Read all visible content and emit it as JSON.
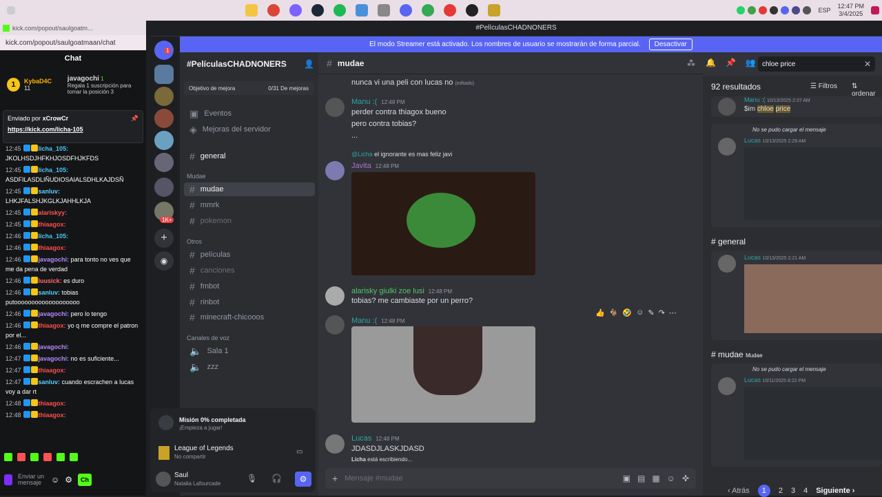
{
  "taskbar": {
    "time": "12:47 PM",
    "date": "3/4/2025",
    "lang": "ESP"
  },
  "kick": {
    "window_title": "kick.com/popout/saulgoatm...",
    "url": "kick.com/popout/saulgoatmaan/chat",
    "chat_title": "Chat",
    "gift_user": "KybaD4C",
    "gift_count": "11",
    "gifter": "javagochi",
    "gifter_count": "1",
    "gift_text": "Regala 1 suscripción para tomar la posición 3",
    "pinned_by": "Enviado por",
    "pinned_user": "xCrowCr",
    "pinned_link": "https://kick.com/licha-105",
    "messages": [
      {
        "t": "12:45",
        "u": "licha_105:",
        "c": "#4fc3f7",
        "m": "JKOLHSDJHFKHJOSDFHJKFDS"
      },
      {
        "t": "12:45",
        "u": "licha_105:",
        "c": "#4fc3f7",
        "m": "ASDFILASDLIÑUDIOSAIALSDHLKAJDSÑ"
      },
      {
        "t": "12:45",
        "u": "sanluv:",
        "c": "#5ad1ff",
        "m": "LHKJFALSHJKGLKJAHHLKJA"
      },
      {
        "t": "12:45",
        "u": "alariskyy:",
        "c": "#ff5252",
        "m": ""
      },
      {
        "t": "12:45",
        "u": "thiaagox:",
        "c": "#ff4d4d",
        "m": ""
      },
      {
        "t": "12:46",
        "u": "licha_105:",
        "c": "#4fc3f7",
        "m": ""
      },
      {
        "t": "12:46",
        "u": "thiaagox:",
        "c": "#ff4d4d",
        "m": ""
      },
      {
        "t": "12:46",
        "u": "javagochi:",
        "c": "#b388ff",
        "m": "para tonto no ves que me da pena de verdad"
      },
      {
        "t": "12:46",
        "u": "luusick:",
        "c": "#ff6b6b",
        "m": "es duro"
      },
      {
        "t": "12:46",
        "u": "sanluv:",
        "c": "#5ad1ff",
        "m": "tobias putooooooooooooooooooo"
      },
      {
        "t": "12:46",
        "u": "javagochi:",
        "c": "#b388ff",
        "m": "pero lo tengo"
      },
      {
        "t": "12:46",
        "u": "thiaagox:",
        "c": "#ff4d4d",
        "m": "yo q me compre el patron por el..."
      },
      {
        "t": "12:46",
        "u": "javagochi:",
        "c": "#b388ff",
        "m": ""
      },
      {
        "t": "12:47",
        "u": "javagochi:",
        "c": "#b388ff",
        "m": "no es suficiente..."
      },
      {
        "t": "12:47",
        "u": "thiaagox:",
        "c": "#ff4d4d",
        "m": ""
      },
      {
        "t": "12:47",
        "u": "sanluv:",
        "c": "#5ad1ff",
        "m": "cuando escrachen a lucas voy a dar rt"
      },
      {
        "t": "12:48",
        "u": "thiaagox:",
        "c": "#ff4d4d",
        "m": ""
      },
      {
        "t": "12:48",
        "u": "thiaagox:",
        "c": "#ff4d4d",
        "m": ""
      }
    ],
    "send_placeholder": "Enviar un mensaje",
    "chat_button": "Ch"
  },
  "discord": {
    "title": "#PelículasCHADNONERS",
    "banner_text": "El modo Streamer está activado. Los nombres de usuario se mostrarán de forma parcial.",
    "banner_button": "Desactivar",
    "server_name": "#PelículasCHADNONERS",
    "boost_label": "Objetivo de mejora",
    "boost_count": "0/31 De mejoras",
    "events": "Eventos",
    "server_boosts": "Mejoras del servidor",
    "general": "general",
    "cat_mudae": "Mudae",
    "cat_otros": "Otros",
    "cat_voice": "Canales de voz",
    "ch_mudae": "mudae",
    "ch_mmrk": "mmrk",
    "ch_pokemon": "pokemon",
    "ch_peliculas": "películas",
    "ch_canciones": "canciones",
    "ch_fmbot": "fmbot",
    "ch_rinbot": "rinbot",
    "ch_minecraft": "minecraft-chicooos",
    "ch_sala1": "Sala 1",
    "ch_zzz": "zzz",
    "mission": "Misión 0% completada",
    "mission_sub": "¡Empieza a jugar!",
    "game": "League of Legends",
    "game_sub": "No compartir",
    "user": "Saul",
    "user_sub": "Natalia Lafourcade",
    "guild_badge": "1",
    "guild_badge2": "1K+",
    "channel_header": "mudae",
    "search_value": "chloe price",
    "messages": {
      "m0": "nunca vi una peli con lucas no",
      "m0_edit": "(editado)",
      "m1_name": "Manu :(",
      "m1_time": "12:48 PM",
      "m1_l1": "perder contra thiagox bueno",
      "m1_l2": "pero contra tobias?",
      "m1_l3": "...",
      "m2_reply_user": "@Licha",
      "m2_reply": "el ignorante es mas feliz javi",
      "m2_name": "Javita",
      "m2_time": "12:48 PM",
      "m3_name": "alarisky giulki zoe lusi",
      "m3_time": "12:48 PM",
      "m3_text": "tobias? me cambiaste por un perro?",
      "m4_name": "Manu :(",
      "m4_time": "12:48 PM",
      "m5_name": "Lucas",
      "m5_time": "12:48 PM",
      "m5_text": "JDASDJLASKJDASD",
      "typing_user": "Licha",
      "typing_text": "está escribiendo..."
    },
    "input_placeholder": "Mensaje #mudae",
    "results": "92 resultados",
    "filters": "Filtros",
    "order": "ordenar",
    "r1_name": "Manu :(",
    "r1_time": "10/13/2025 2:37 AM",
    "r1_text": "$im",
    "r1_hl1": "chloe",
    "r1_hl2": "price",
    "r2_fail": "No se pudo cargar el mensaje",
    "r2_name": "Lucas",
    "r2_time": "10/13/2025 2:29 AM",
    "r3_channel": "general",
    "r3_name": "Lucas",
    "r3_time": "10/13/2025 2:21 AM",
    "r4_channel": "mudae",
    "r4_cat": "Mudae",
    "r4_fail": "No se pudo cargar el mensaje",
    "r4_name": "Lucas",
    "r4_time": "10/11/2025 8:22 PM",
    "pag_prev": "Atrás",
    "pages": [
      "1",
      "2",
      "3",
      "4"
    ],
    "pag_next": "Siguiente"
  }
}
